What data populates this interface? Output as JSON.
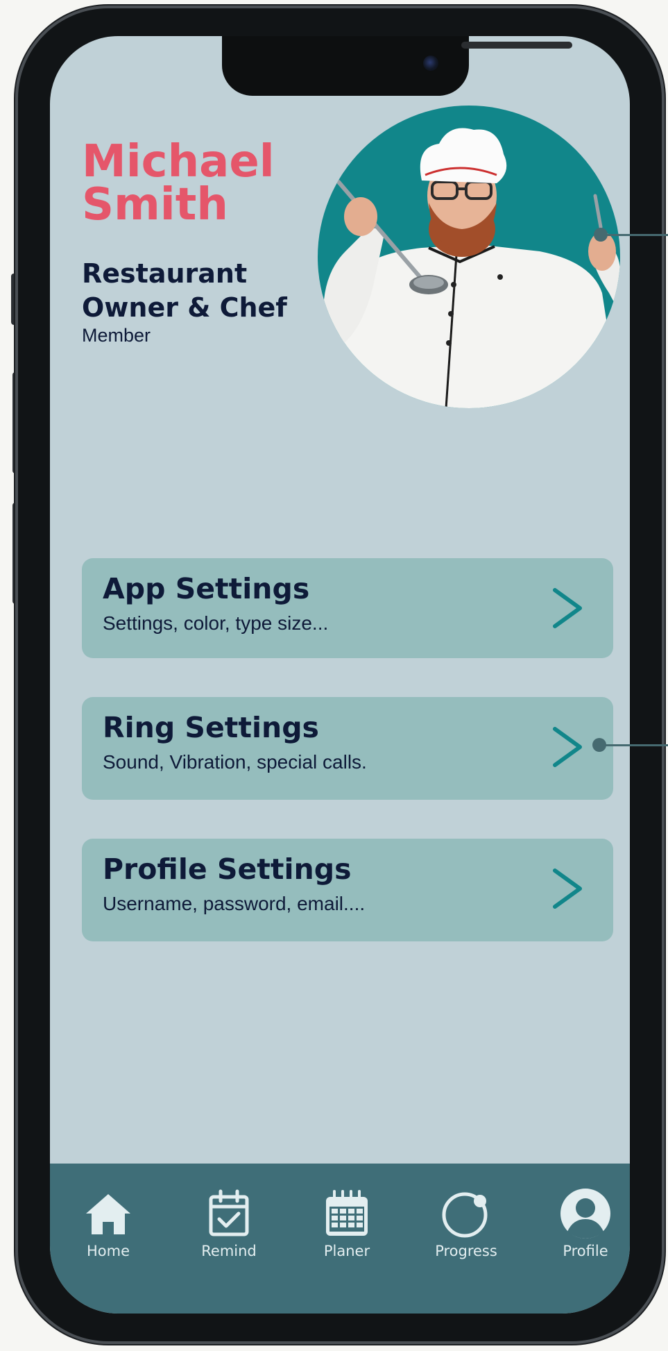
{
  "profile": {
    "first_name": "Michael",
    "last_name": "Smith",
    "role_line1": "Restaurant",
    "role_line2": "Owner & Chef",
    "status": "Member"
  },
  "settings": [
    {
      "title": "App Settings",
      "subtitle": "Settings, color, type size...",
      "icon": "chevron-right-icon"
    },
    {
      "title": "Ring Settings",
      "subtitle": "Sound, Vibration, special calls.",
      "icon": "chevron-right-icon"
    },
    {
      "title": "Profile Settings",
      "subtitle": "Username, password, email....",
      "icon": "chevron-right-icon"
    }
  ],
  "nav": [
    {
      "label": "Home",
      "icon": "home-icon"
    },
    {
      "label": "Remind",
      "icon": "calendar-check-icon"
    },
    {
      "label": "Planer",
      "icon": "calendar-grid-icon"
    },
    {
      "label": "Progress",
      "icon": "progress-ring-icon"
    },
    {
      "label": "Profile",
      "icon": "user-icon",
      "active": true
    }
  ],
  "colors": {
    "screen_bg": "#c0d1d7",
    "name_color": "#e5566a",
    "card_bg": "#95bdbd",
    "accent": "#11868a",
    "nav_bg": "#3f6e78",
    "text_dark": "#0e1a38"
  }
}
